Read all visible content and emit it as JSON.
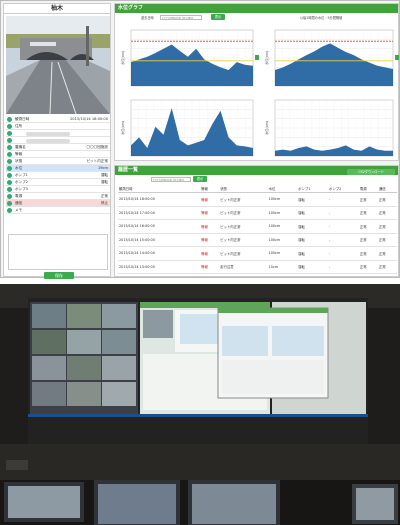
{
  "location": {
    "name": "柚木"
  },
  "info_panel": {
    "rows": [
      {
        "label": "観測日時",
        "value": "2015/10/14 18:00:00",
        "style": "normal"
      },
      {
        "label": "住所",
        "value": "",
        "style": "normal"
      },
      {
        "label": "",
        "value": "",
        "style": "normal"
      },
      {
        "label": "",
        "value": "",
        "style": "normal"
      },
      {
        "label": "農機名",
        "value": "〇〇〇団施設",
        "style": "normal"
      },
      {
        "label": "警報",
        "value": "",
        "style": "normal"
      },
      {
        "label": "状態",
        "value": "ピット内正常",
        "style": "normal"
      },
      {
        "label": "水位",
        "value": "19cm",
        "style": "blue"
      },
      {
        "label": "ポンプ1",
        "value": "運転",
        "style": "normal"
      },
      {
        "label": "ポンプ2",
        "value": "運転",
        "style": "normal"
      },
      {
        "label": "ポンプ3",
        "value": "",
        "style": "normal"
      },
      {
        "label": "電源",
        "value": "正常",
        "style": "normal"
      },
      {
        "label": "通信",
        "value": "停止",
        "style": "pink"
      },
      {
        "label": "メモ",
        "value": "",
        "style": "normal"
      }
    ],
    "save_label": "保存"
  },
  "graph_panel": {
    "title": "水位グラフ",
    "period_label": "過去日時",
    "date_placeholder": "YYYY/MM/DD HH:MM",
    "show_label": "表示",
    "range_note": "以後2時間の水位・5分間隔値",
    "y_label": "水位(cm)"
  },
  "list_panel": {
    "title": "履歴一覧",
    "date_placeholder": "YYYY/MM/DD HH:MM",
    "show_label": "表示",
    "csv_label": "CSVダウンロード",
    "columns": [
      "観測日時",
      "警報",
      "状態",
      "水位",
      "ポンプ1",
      "ポンプ2",
      "電源",
      "通信"
    ],
    "rows": [
      [
        "2015/10/14 18:00:00",
        "警報",
        "ピット内正常",
        "100cm",
        "運転",
        "-",
        "正常",
        "正常"
      ],
      [
        "2015/10/14 17:00:00",
        "警報",
        "ピット内正常",
        "100cm",
        "運転",
        "-",
        "正常",
        "正常"
      ],
      [
        "2015/10/14 16:00:00",
        "警報",
        "ピット内正常",
        "100cm",
        "運転",
        "-",
        "正常",
        "正常"
      ],
      [
        "2015/10/14 15:00:00",
        "警報",
        "ピット内正常",
        "100cm",
        "運転",
        "-",
        "正常",
        "正常"
      ],
      [
        "2015/10/14 14:00:00",
        "警報",
        "ピット内正常",
        "100cm",
        "運転",
        "-",
        "正常",
        "正常"
      ],
      [
        "2015/10/14 13:00:00",
        "警報",
        "走行注意",
        "15cm",
        "運転",
        "-",
        "正常",
        "正常"
      ]
    ]
  },
  "colors": {
    "green": "#3fa23a",
    "chart_fill": "#1e5f9e",
    "limit_red": "#e23b3b",
    "limit_yellow": "#e8d23a"
  }
}
